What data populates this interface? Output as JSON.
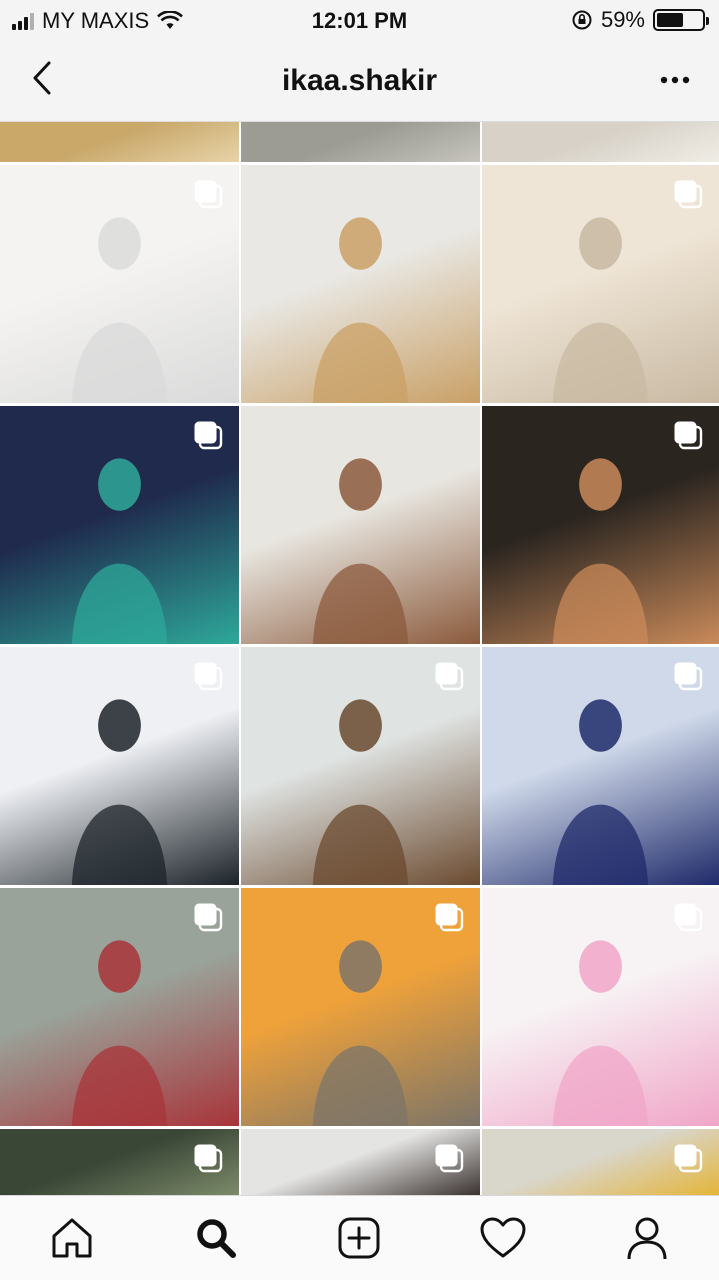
{
  "status_bar": {
    "carrier": "MY MAXIS",
    "time": "12:01 PM",
    "battery_percent": "59%",
    "battery_level": 0.59,
    "icons": [
      "signal-icon",
      "wifi-icon",
      "orientation-lock-icon",
      "battery-icon"
    ]
  },
  "header": {
    "title": "ikaa.shakir",
    "back_icon": "chevron-left-icon",
    "more_icon": "more-dots-icon"
  },
  "grid": {
    "posts": [
      {
        "id": "row0-a",
        "colors": [
          "#c9a86a",
          "#e7d3a8"
        ],
        "multi": false
      },
      {
        "id": "row0-b",
        "colors": [
          "#9c9c94",
          "#c7c5bd"
        ],
        "multi": false
      },
      {
        "id": "row0-c",
        "colors": [
          "#d7d1c7",
          "#f0ede6"
        ],
        "multi": false
      },
      {
        "id": "p1",
        "colors": [
          "#f4f3f1",
          "#dadada"
        ],
        "multi": true
      },
      {
        "id": "p2",
        "colors": [
          "#e9e8e4",
          "#c9a066"
        ],
        "multi": false
      },
      {
        "id": "p3",
        "colors": [
          "#efe5d6",
          "#c8b9a2"
        ],
        "multi": true
      },
      {
        "id": "p4",
        "colors": [
          "#1f2a4d",
          "#2ea89a"
        ],
        "multi": true
      },
      {
        "id": "p5",
        "colors": [
          "#e8e6e0",
          "#8b5a3c"
        ],
        "multi": false
      },
      {
        "id": "p6",
        "colors": [
          "#2b2520",
          "#c98a5a"
        ],
        "multi": true
      },
      {
        "id": "p7",
        "colors": [
          "#eef0f4",
          "#1c2329"
        ],
        "multi": true
      },
      {
        "id": "p8",
        "colors": [
          "#dfe3e2",
          "#6b4a2f"
        ],
        "multi": true
      },
      {
        "id": "p9",
        "colors": [
          "#cfd9ea",
          "#1f2a6a"
        ],
        "multi": true
      },
      {
        "id": "p10",
        "colors": [
          "#9aa39a",
          "#a8343a"
        ],
        "multi": true
      },
      {
        "id": "p11",
        "colors": [
          "#f0a23a",
          "#7c7468"
        ],
        "multi": true
      },
      {
        "id": "p12",
        "colors": [
          "#f7f2f4",
          "#f0a6c8"
        ],
        "multi": true
      },
      {
        "id": "row5-a",
        "colors": [
          "#3a4636",
          "#7c8a6a"
        ],
        "multi": true
      },
      {
        "id": "row5-b",
        "colors": [
          "#e4e4e2",
          "#3a3230"
        ],
        "multi": true
      },
      {
        "id": "row5-c",
        "colors": [
          "#d9d6cc",
          "#e5b53a"
        ],
        "multi": true
      }
    ]
  },
  "bottom_nav": {
    "items": [
      "home-icon",
      "search-icon",
      "new-post-icon",
      "activity-heart-icon",
      "profile-icon"
    ],
    "active": "search-icon"
  }
}
